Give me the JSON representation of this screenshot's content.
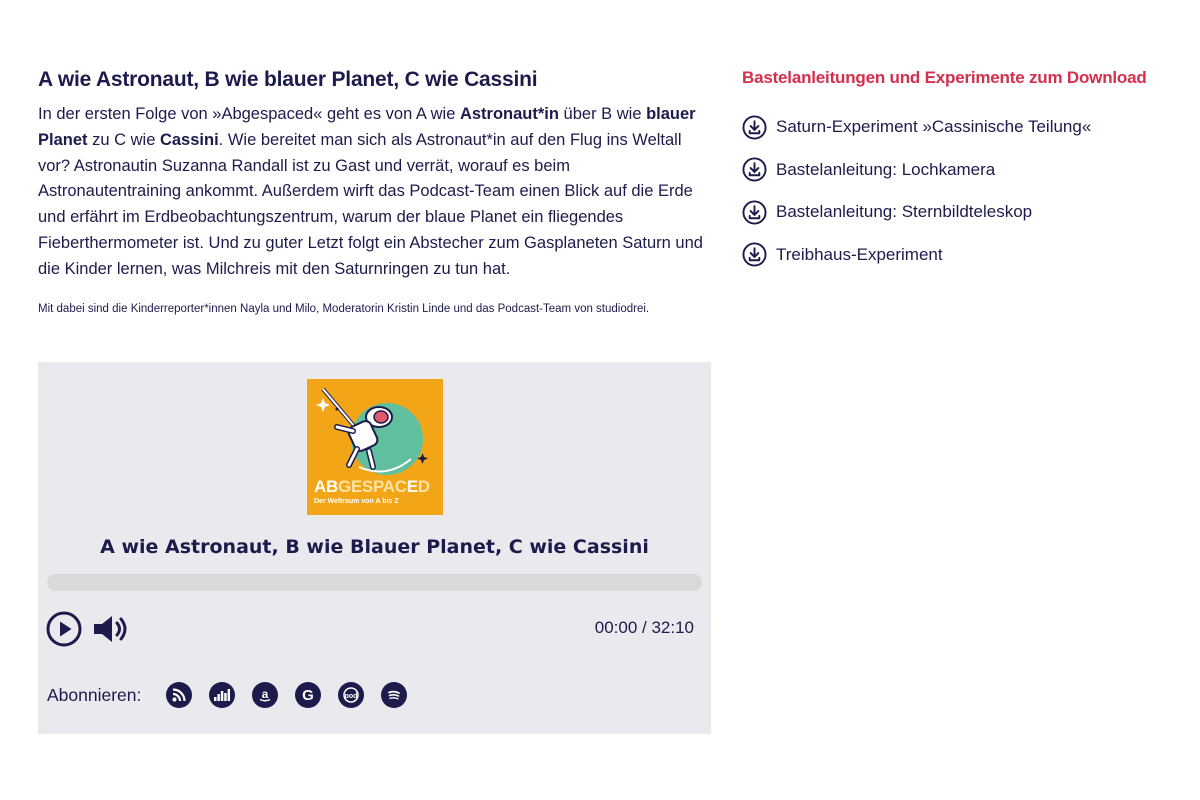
{
  "article": {
    "title": "A wie Astronaut, B wie blauer Planet, C wie Cassini",
    "body": [
      {
        "t": "In der ersten Folge von »Abgespaced« geht es von A wie "
      },
      {
        "t": "Astronaut*in",
        "b": true
      },
      {
        "t": " über B wie "
      },
      {
        "t": "blauer Planet",
        "b": true
      },
      {
        "t": " zu C wie "
      },
      {
        "t": "Cassini",
        "b": true
      },
      {
        "t": ". Wie bereitet man sich als Astronaut*in auf den Flug ins Weltall vor? Astronautin Suzanna Randall ist zu Gast und verrät, worauf es beim Astronautentraining ankommt. Außerdem wirft das Podcast-Team einen Blick auf die Erde und erfährt im Erdbeobachtungszentrum, warum der blaue Planet ein fliegendes Fieberthermometer ist. Und zu guter Letzt folgt ein Abstecher zum Gasplaneten Saturn und die Kinder lernen, was Milchreis mit den Saturnringen zu tun hat."
      }
    ],
    "credits": "Mit dabei sind die Kinderreporter*innen Nayla und Milo, Moderatorin Kristin Linde und das Podcast-Team von studiodrei."
  },
  "player": {
    "cover": {
      "brand_ab": "AB",
      "brand_gespac": "GESPAC",
      "brand_e": "E",
      "brand_d": "D",
      "subtitle": "Der Weltraum von A bis Z"
    },
    "episode_title": "A wie Astronaut, B wie Blauer Planet, C wie Cassini",
    "progress": 0,
    "current_time": "00:00",
    "separator": " / ",
    "duration": "32:10",
    "subscribe_label": "Abonnieren:",
    "subscribe_icons": [
      "rss-icon",
      "deezer-icon",
      "amazon-music-icon",
      "google-podcasts-icon",
      "pocket-casts-icon",
      "spotify-icon"
    ],
    "colors": {
      "background": "#e9e9ee",
      "accent": "#1d1b4c",
      "track": "#d9d9d9",
      "cover": "#f2a516"
    }
  },
  "sidebar": {
    "heading": "Bastelanleitungen und Experimente zum Download",
    "heading_color": "#d3304d",
    "items": [
      {
        "label": "Saturn-Experiment »Cassinische Teilung«",
        "icon": "download-icon"
      },
      {
        "label": "Bastelanleitung: Lochkamera",
        "icon": "download-icon"
      },
      {
        "label": "Bastelanleitung: Sternbildteleskop",
        "icon": "download-icon"
      },
      {
        "label": "Treibhaus-Experiment",
        "icon": "download-icon"
      }
    ]
  }
}
